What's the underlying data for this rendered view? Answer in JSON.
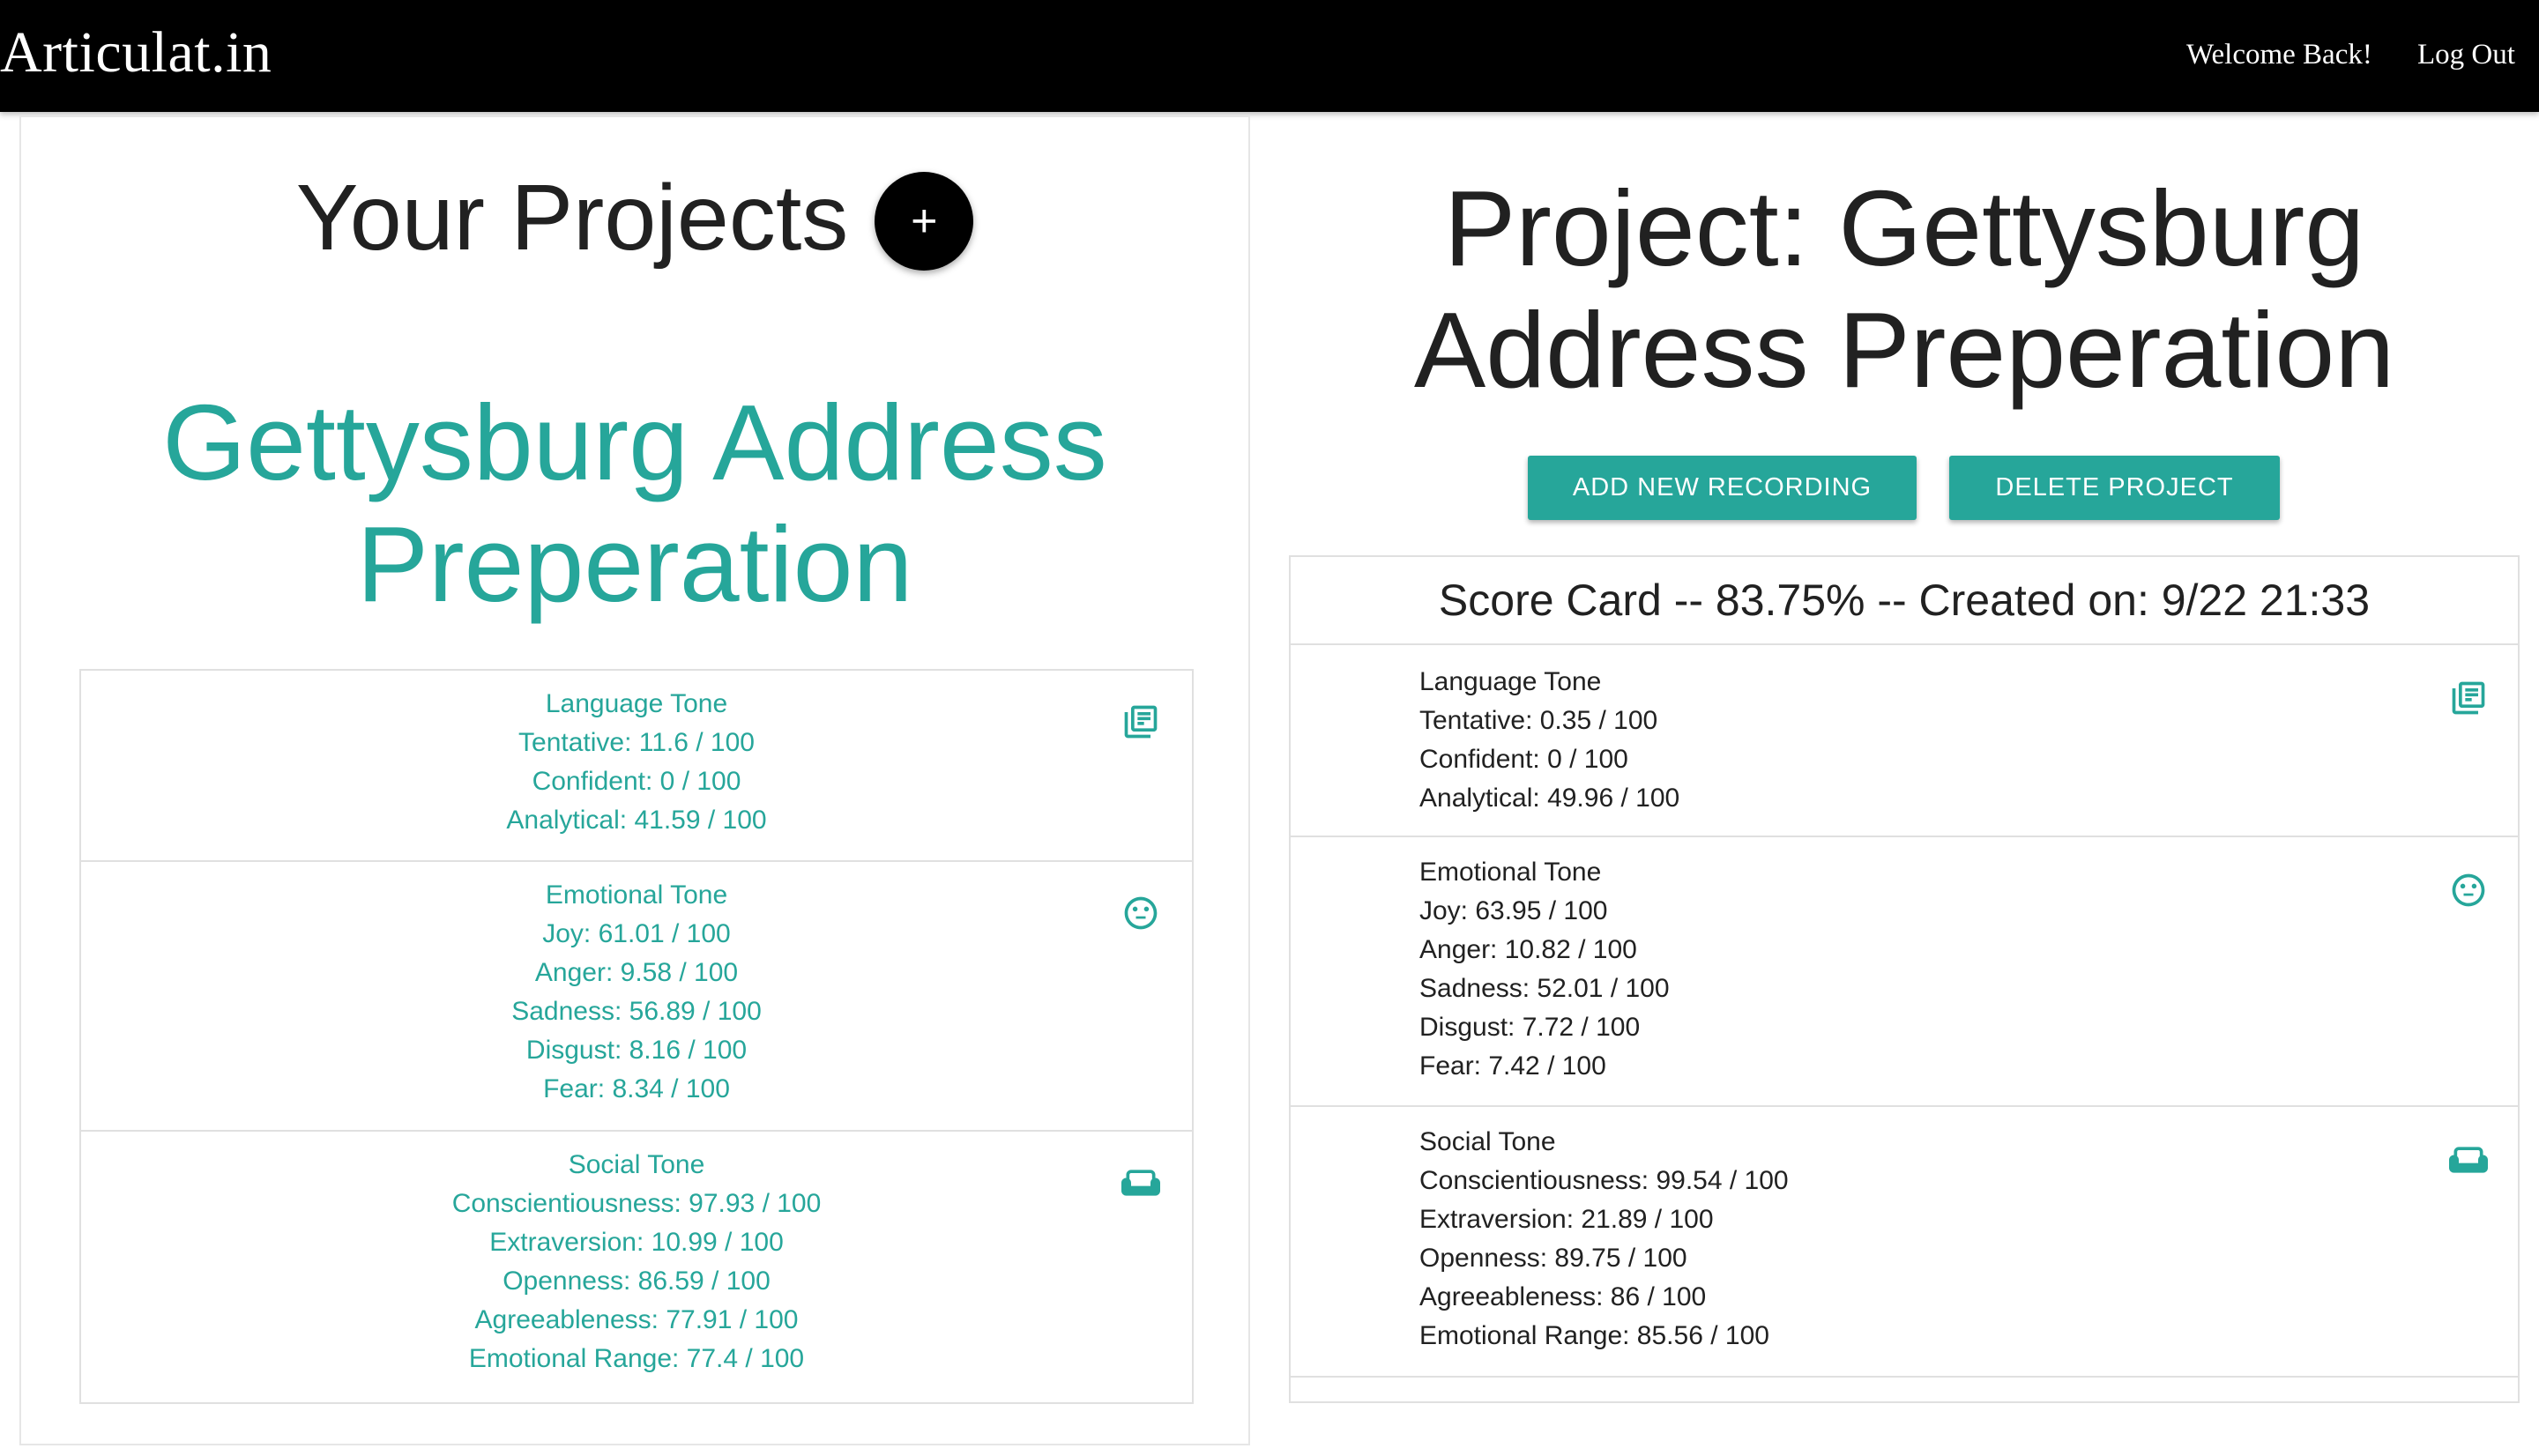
{
  "nav": {
    "brand": "Articulat.in",
    "welcome": "Welcome Back!",
    "logout": "Log Out"
  },
  "projects": {
    "heading": "Your Projects",
    "add_button": "+",
    "selected_title": "Gettysburg Address Preperation",
    "summary": {
      "language": {
        "title": "Language Tone",
        "icon": "article-icon",
        "metrics": [
          "Tentative: 11.6 / 100",
          "Confident: 0 / 100",
          "Analytical: 41.59 / 100"
        ]
      },
      "emotional": {
        "title": "Emotional Tone",
        "icon": "neutral-face-icon",
        "metrics": [
          "Joy: 61.01 / 100",
          "Anger: 9.58 / 100",
          "Sadness: 56.89 / 100",
          "Disgust: 8.16 / 100",
          "Fear: 8.34 / 100"
        ]
      },
      "social": {
        "title": "Social Tone",
        "icon": "sofa-icon",
        "metrics": [
          "Conscientiousness: 97.93 / 100",
          "Extraversion: 10.99 / 100",
          "Openness: 86.59 / 100",
          "Agreeableness: 77.91 / 100",
          "Emotional Range: 77.4 / 100"
        ]
      }
    }
  },
  "detail": {
    "title": "Project: Gettysburg Address Preperation",
    "add_recording": "ADD NEW RECORDING",
    "delete_project": "DELETE PROJECT",
    "scorecard": {
      "header": "Score Card -- 83.75% -- Created on: 9/22 21:33",
      "language": {
        "title": "Language Tone",
        "metrics": [
          "Tentative: 0.35 / 100",
          "Confident: 0 / 100",
          "Analytical: 49.96 / 100"
        ]
      },
      "emotional": {
        "title": "Emotional Tone",
        "metrics": [
          "Joy: 63.95 / 100",
          "Anger: 10.82 / 100",
          "Sadness: 52.01 / 100",
          "Disgust: 7.72 / 100",
          "Fear: 7.42 / 100"
        ]
      },
      "social": {
        "title": "Social Tone",
        "metrics": [
          "Conscientiousness: 99.54 / 100",
          "Extraversion: 21.89 / 100",
          "Openness: 89.75 / 100",
          "Agreeableness: 86 / 100",
          "Emotional Range: 85.56 / 100"
        ]
      }
    }
  },
  "colors": {
    "accent": "#26a69a",
    "navbar": "#000000",
    "text": "#212121",
    "border": "#e0e0e0"
  }
}
